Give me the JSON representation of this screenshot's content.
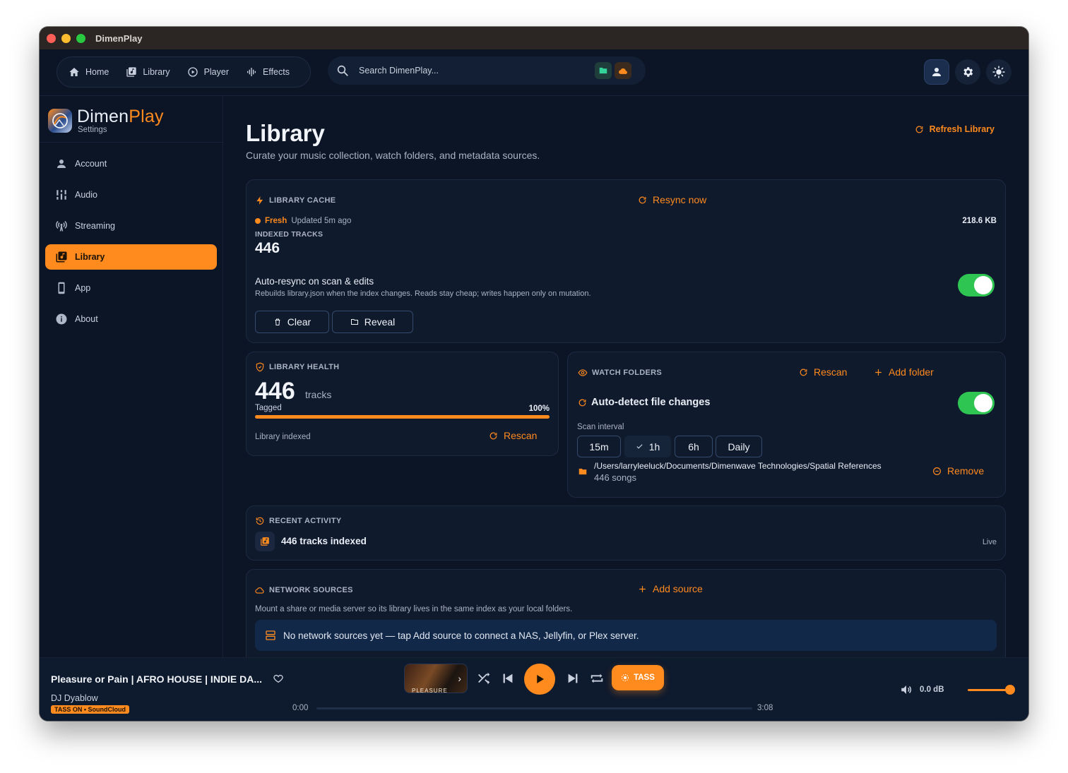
{
  "window": {
    "title": "DimenPlay"
  },
  "nav": [
    {
      "label": "Home",
      "icon": "home-icon"
    },
    {
      "label": "Library",
      "icon": "library-icon"
    },
    {
      "label": "Player",
      "icon": "play-circle-icon"
    },
    {
      "label": "Effects",
      "icon": "waveform-icon"
    }
  ],
  "search": {
    "placeholder": "Search DimenPlay..."
  },
  "brand": {
    "name_part1": "Dimen",
    "name_part2": "Play",
    "subtitle": "Settings"
  },
  "sidebar": {
    "items": [
      {
        "label": "Account",
        "icon": "person-icon"
      },
      {
        "label": "Audio",
        "icon": "equalizer-icon"
      },
      {
        "label": "Streaming",
        "icon": "broadcast-icon"
      },
      {
        "label": "Library",
        "icon": "library-icon",
        "active": true
      },
      {
        "label": "App",
        "icon": "phone-icon"
      },
      {
        "label": "About",
        "icon": "info-icon"
      }
    ]
  },
  "page": {
    "title": "Library",
    "subtitle": "Curate your music collection, watch folders, and metadata sources.",
    "refresh_label": "Refresh Library"
  },
  "cache": {
    "heading": "LIBRARY CACHE",
    "resync_label": "Resync now",
    "status": "Fresh",
    "updated": "Updated 5m ago",
    "size": "218.6 KB",
    "indexed_label": "INDEXED TRACKS",
    "indexed_count": "446",
    "auto_title": "Auto-resync on scan & edits",
    "auto_desc": "Rebuilds library.json when the index changes. Reads stay cheap; writes happen only on mutation.",
    "auto_enabled": true,
    "clear_label": "Clear",
    "reveal_label": "Reveal"
  },
  "health": {
    "heading": "LIBRARY HEALTH",
    "count": "446",
    "unit": "tracks",
    "tagged_label": "Tagged",
    "tagged_pct": "100%",
    "tagged_fraction": 1.0,
    "status": "Library indexed",
    "rescan_label": "Rescan"
  },
  "watch": {
    "heading": "WATCH FOLDERS",
    "rescan_label": "Rescan",
    "add_label": "Add folder",
    "auto_detect_label": "Auto-detect file changes",
    "auto_detect_enabled": true,
    "scan_interval_label": "Scan interval",
    "intervals": [
      "15m",
      "1h",
      "6h",
      "Daily"
    ],
    "selected_interval": "1h",
    "folder_path": "/Users/larryleeluck/Documents/Dimenwave Technologies/Spatial References",
    "folder_count": "446 songs",
    "remove_label": "Remove"
  },
  "activity": {
    "heading": "RECENT ACTIVITY",
    "item": "446 tracks indexed",
    "badge": "Live"
  },
  "network": {
    "heading": "NETWORK SOURCES",
    "add_label": "Add source",
    "desc": "Mount a share or media server so its library lives in the same index as your local folders.",
    "empty_text": "No network sources yet — tap Add source to connect a NAS, Jellyfin, or Plex server."
  },
  "player": {
    "title": "Pleasure or Pain | AFRO HOUSE | INDIE DA...",
    "artist": "DJ Dyablow",
    "badge": "TASS ON • SoundCloud",
    "art_caption": "PLEASURE",
    "tass_label": "TASS",
    "time_current": "0:00",
    "time_total": "3:08",
    "progress_fraction": 0.0,
    "volume": "0.0 dB"
  },
  "colors": {
    "accent": "#ff8a1e",
    "background": "#0c1526",
    "card": "#0f1a2d",
    "toggle_on": "#2fc553"
  }
}
